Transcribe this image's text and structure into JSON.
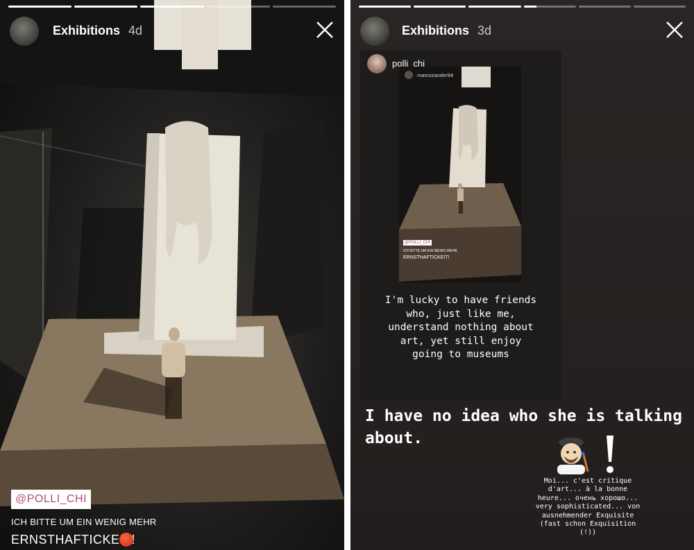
{
  "left_story": {
    "account_name": "Exhibitions",
    "time_ago": "4d",
    "progress": [
      1,
      1,
      1,
      0,
      0
    ],
    "mention_tag": "@POLLI_CHI",
    "caption_line1": "ICH BITTE UM EIN WENIG MEHR",
    "caption_line2": "ERNSTHAFTICKEIT!",
    "emoji": "angry-face"
  },
  "right_story": {
    "account_name": "Exhibitions",
    "time_ago": "3d",
    "progress": [
      1,
      1,
      1,
      0.25,
      0,
      0
    ],
    "shared_post": {
      "username": "polli_chi",
      "inner_username": "marcozander94",
      "inner_tag": "@POLLI_CHI",
      "inner_caption_line1": "ICH BITTE UM EIN WENIG MEHR",
      "inner_caption_line2": "ERNSTHAFTICKEIT!",
      "text": "I'm lucky to have friends\nwho, just like me,\nunderstand nothing about\nart, yet still enjoy\ngoing to museums"
    },
    "reply_text": "I have no idea who she is talking about.",
    "reply_small": "Moi... c'est critique\nd'art... à la bonne\nheure... очень хорошо...\nvery sophisticated... von\nausnehmender Exquisite\n(fast schon Exquisition\n(!))",
    "stickers": [
      "artist-emoji",
      "exclamation-mark"
    ]
  }
}
